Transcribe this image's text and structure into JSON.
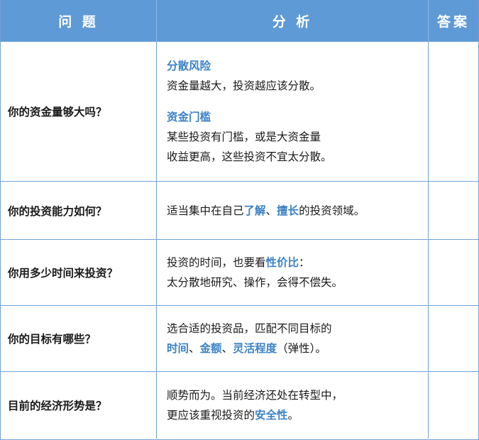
{
  "header": {
    "col_question": "问  题",
    "col_analysis": "分  析",
    "col_answer": "答案"
  },
  "rows": [
    {
      "question": "你的资金量够大吗？",
      "analysis": {
        "block1_title": "分散风险",
        "block1_text": "资金量越大，投资越应该分散。",
        "block2_title": "资金门槛",
        "block2_line1": "某些投资有门槛，或是大资金量",
        "block2_line2": "收益更高，这些投资不宜太分散。"
      }
    },
    {
      "question": "你的投资能力如何？",
      "analysis": {
        "t1": "适当集中在自己",
        "h1": "了解",
        "t2": "、",
        "h2": "擅长",
        "t3": "的投资领域。"
      }
    },
    {
      "question": "你用多少时间来投资？",
      "analysis": {
        "t1": "投资的时间，也要看",
        "h1": "性价比",
        "t2": "：",
        "line2": "太分散地研究、操作，会得不偿失。"
      }
    },
    {
      "question": "你的目标有哪些？",
      "analysis": {
        "line1": "选合适的投资品，匹配不同目标的",
        "h1": "时间",
        "t1": "、",
        "h2": "金额",
        "t2": "、",
        "h3": "灵活程度",
        "t3": "（弹性）。"
      }
    },
    {
      "question": "目前的经济形势是？",
      "analysis": {
        "line1": "顺势而为。当前经济还处在转型中，",
        "t1": "更应该重视投资的",
        "h1": "安全性",
        "t2": "。"
      }
    }
  ],
  "colors": {
    "header_bg": "#5e9ad6",
    "highlight": "#3b82c6",
    "border": "#6fa3d8"
  }
}
